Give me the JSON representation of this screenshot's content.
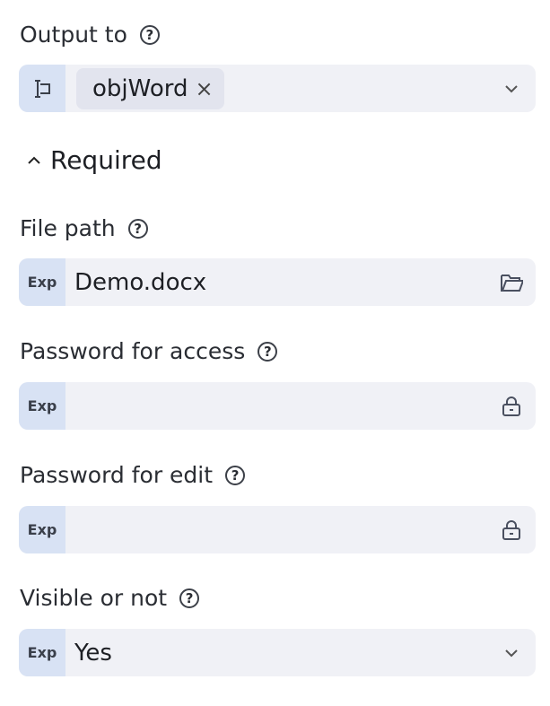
{
  "output_to": {
    "label": "Output to",
    "chip": "objWord"
  },
  "section": {
    "label": "Required"
  },
  "fields": [
    {
      "label": "File path",
      "badge": "Exp",
      "value": "Demo.docx",
      "icon": "folder-icon"
    },
    {
      "label": "Password for access",
      "badge": "Exp",
      "value": "",
      "icon": "lock-icon"
    },
    {
      "label": "Password for edit",
      "badge": "Exp",
      "value": "",
      "icon": "lock-icon"
    },
    {
      "label": "Visible or not",
      "badge": "Exp",
      "value": "Yes",
      "icon": "chevron-down-icon"
    }
  ],
  "help_glyph": "?"
}
